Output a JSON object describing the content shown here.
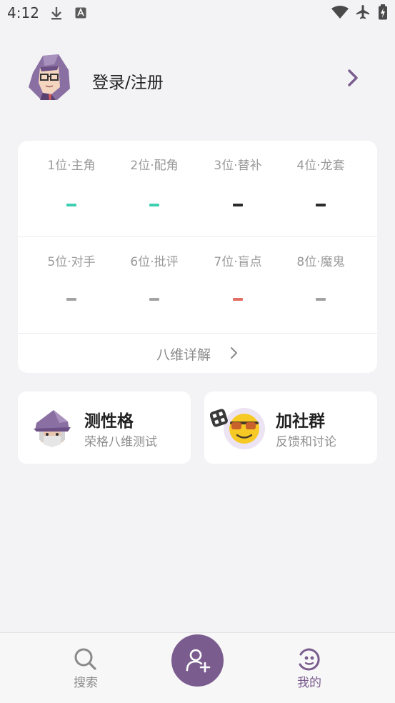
{
  "status_bar": {
    "time": "4:12"
  },
  "profile": {
    "login_label": "登录/注册"
  },
  "ranks": {
    "row1": [
      {
        "label": "1位·主角",
        "value_color": "#3ecfb1"
      },
      {
        "label": "2位·配角",
        "value_color": "#3ecfb1"
      },
      {
        "label": "3位·替补",
        "value_color": "#2b2b2b"
      },
      {
        "label": "4位·龙套",
        "value_color": "#2b2b2b"
      }
    ],
    "row2": [
      {
        "label": "5位·对手",
        "value_color": "#a3a3a3"
      },
      {
        "label": "6位·批评",
        "value_color": "#a3a3a3"
      },
      {
        "label": "7位·盲点",
        "value_color": "#e07065"
      },
      {
        "label": "8位·魔鬼",
        "value_color": "#a3a3a3"
      }
    ],
    "detail_label": "八维详解"
  },
  "features": {
    "test": {
      "title": "测性格",
      "subtitle": "荣格八维测试",
      "icon": "wizard-avatar-icon"
    },
    "group": {
      "title": "加社群",
      "subtitle": "反馈和讨论",
      "icon": "sunglasses-emoji-icon"
    }
  },
  "bottom_nav": {
    "search_label": "搜索",
    "mine_label": "我的",
    "fab_icon": "add-person-icon"
  },
  "colors": {
    "accent": "#7b5c8e",
    "background": "#f3f3f5"
  }
}
